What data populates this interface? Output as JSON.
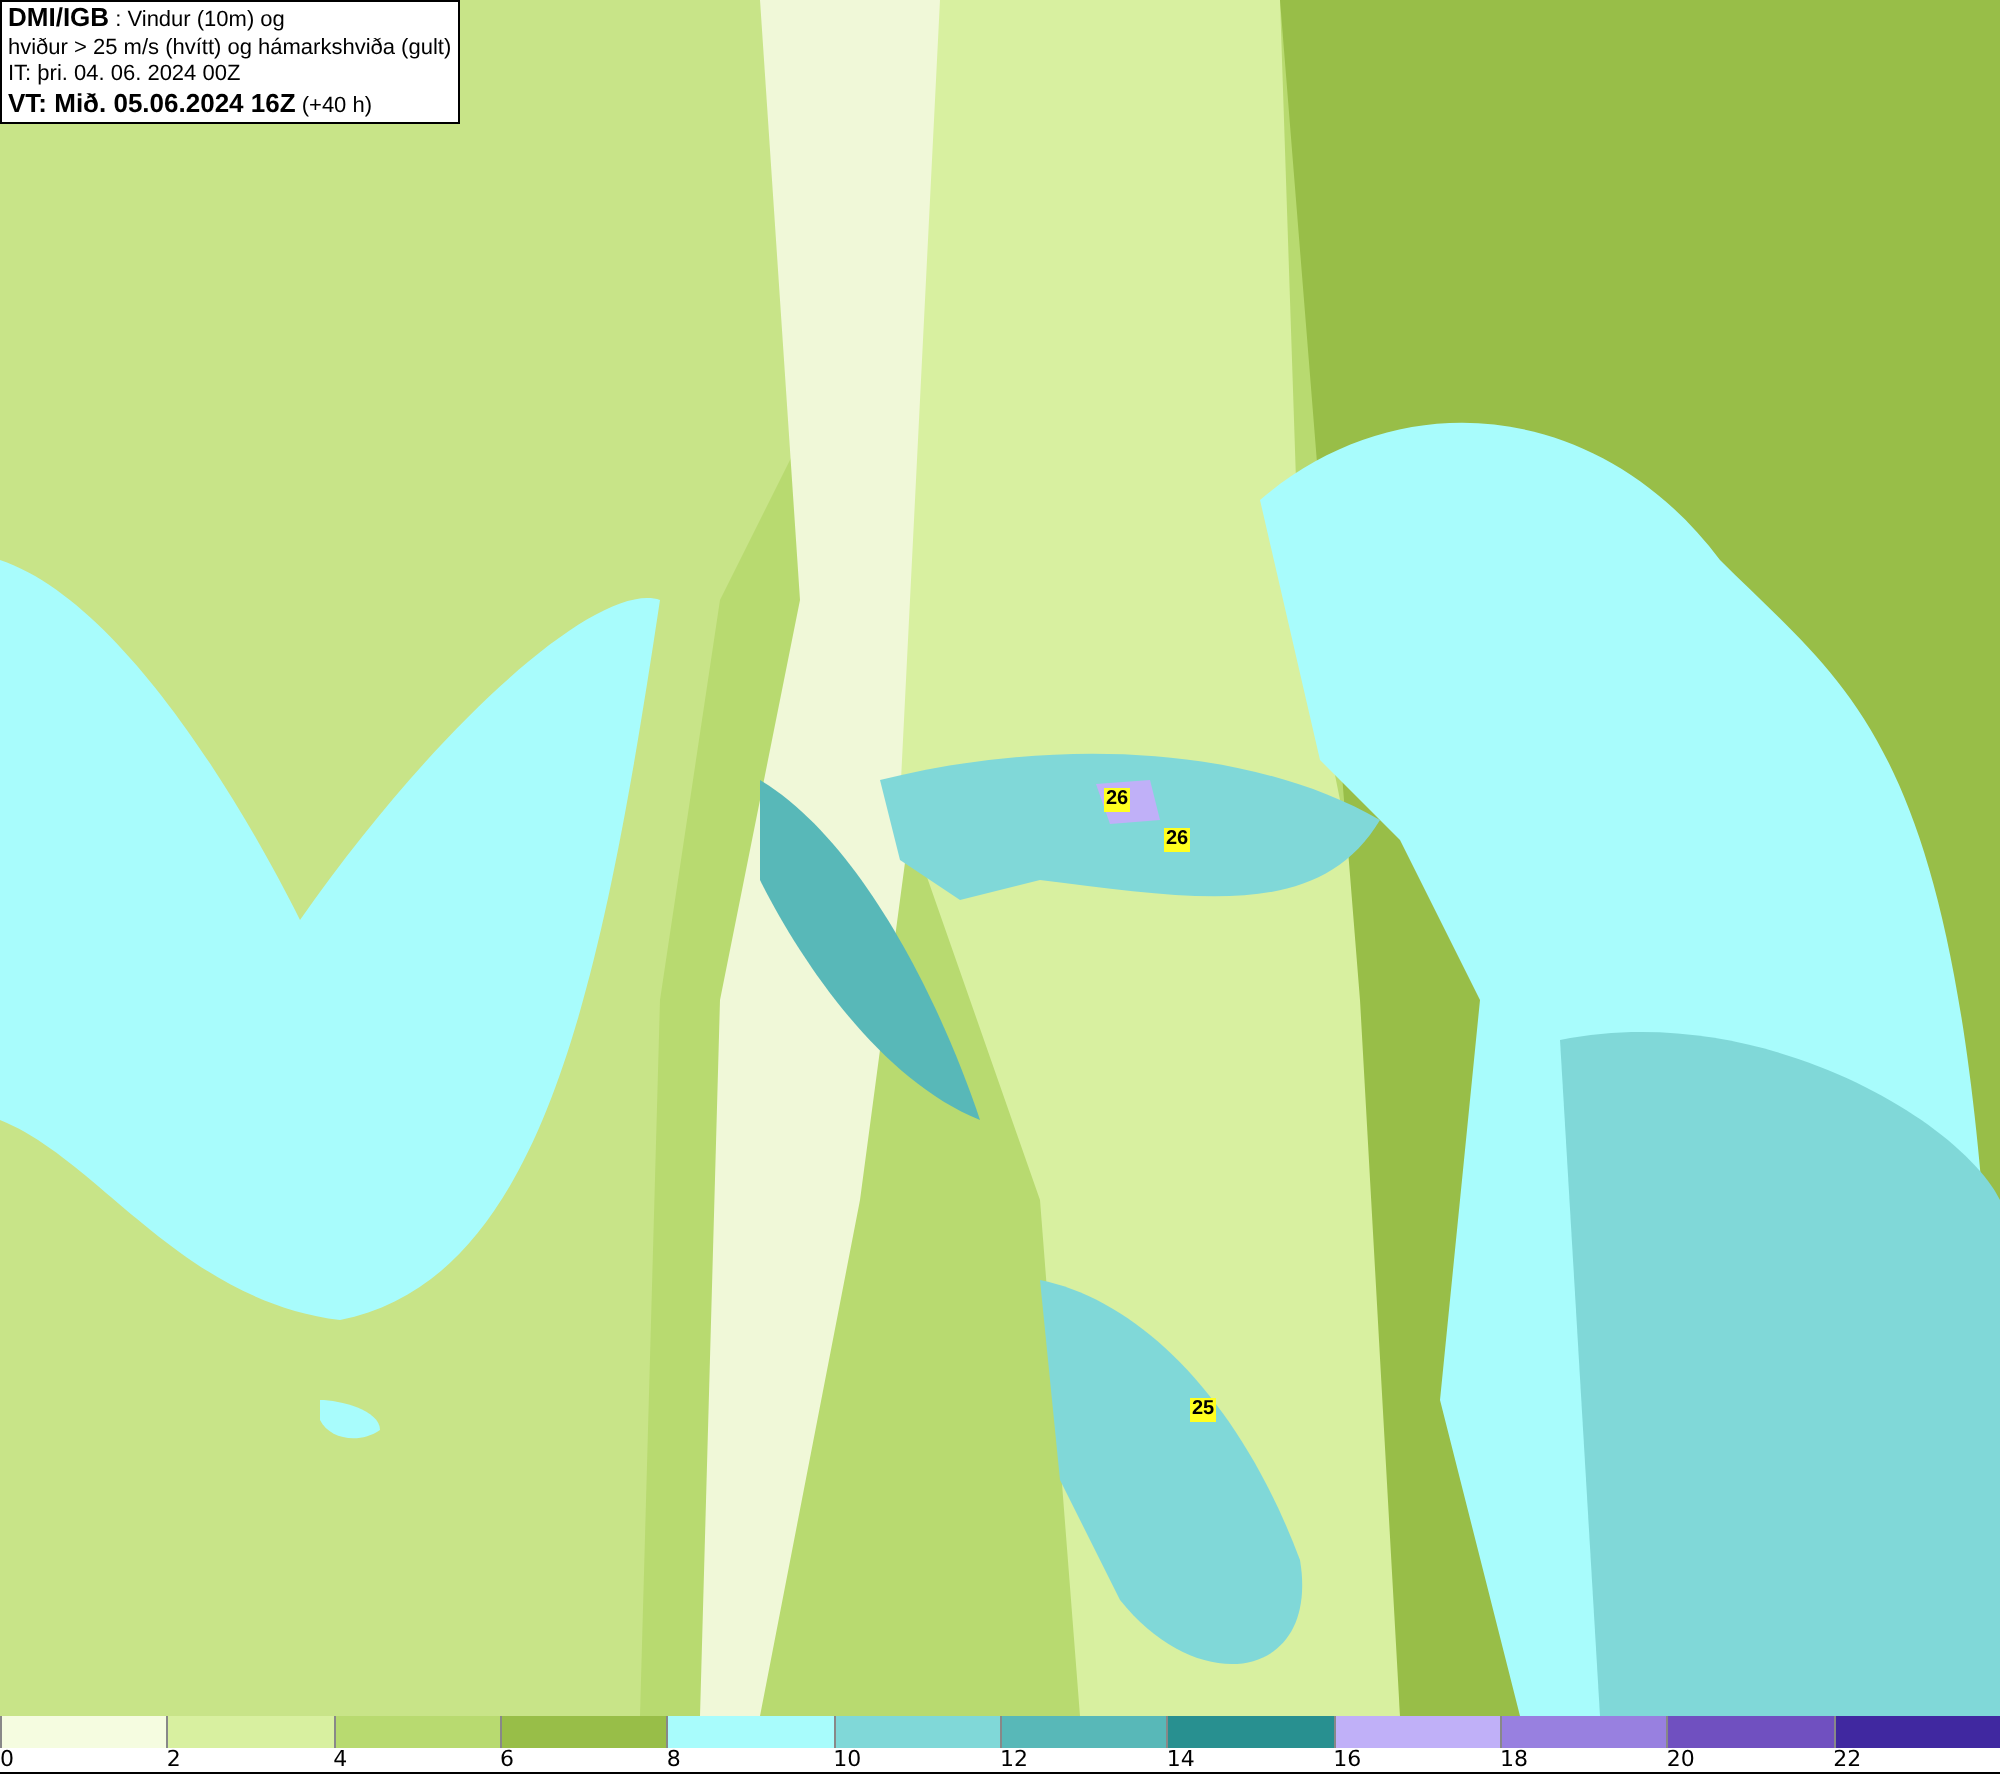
{
  "header": {
    "lines": [
      "**DMI/IGB** : Vindur (10m) og",
      "hviður > 25 m/s (hvítt) og hámarkshviða (gult)",
      "IT: þri. 04. 06. 2024 00Z",
      "**VT: Mið. 05.06.2024 16Z** (+40 h)"
    ]
  },
  "map": {
    "gust_labels": [
      "26",
      "26",
      "25"
    ]
  },
  "legend": [
    {
      "label": "0",
      "color": "#f5fce0"
    },
    {
      "label": "2",
      "color": "#d8f0a0"
    },
    {
      "label": "4",
      "color": "#b8da70"
    },
    {
      "label": "6",
      "color": "#98be48"
    },
    {
      "label": "8",
      "color": "#a8fcfc"
    },
    {
      "label": "10",
      "color": "#80d8d8"
    },
    {
      "label": "12",
      "color": "#58b8b8"
    },
    {
      "label": "14",
      "color": "#289090"
    },
    {
      "label": "16",
      "color": "#c0b0f8"
    },
    {
      "label": "18",
      "color": "#9880e0"
    },
    {
      "label": "20",
      "color": "#7050c0"
    },
    {
      "label": "22",
      "color": "#4028a0"
    }
  ]
}
